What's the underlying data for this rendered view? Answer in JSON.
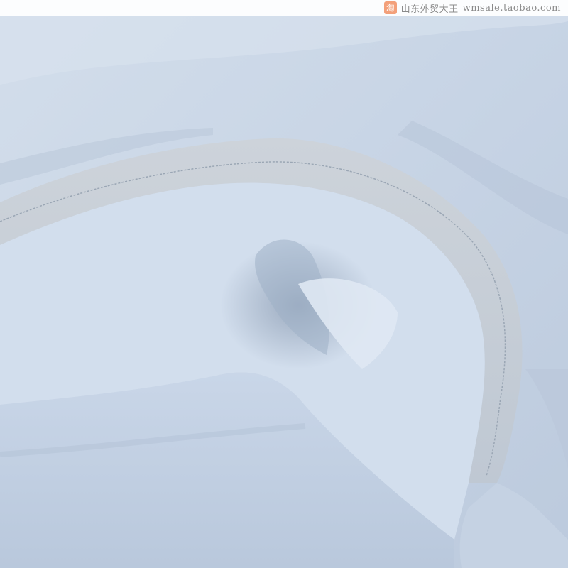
{
  "image": {
    "description_subject": "light-blue-cotton-fabric-fold",
    "icon": "taobao-icon"
  },
  "watermark": {
    "logo_char": "淘",
    "shop_name": "山东外贸大王",
    "url": "wmsale.taobao.com"
  },
  "colors": {
    "fabric": "#c9d6e6",
    "fabric_light": "#d9e4f0",
    "fabric_shadow": "#a9b8cb",
    "watermark_icon": "#f3a07a"
  }
}
